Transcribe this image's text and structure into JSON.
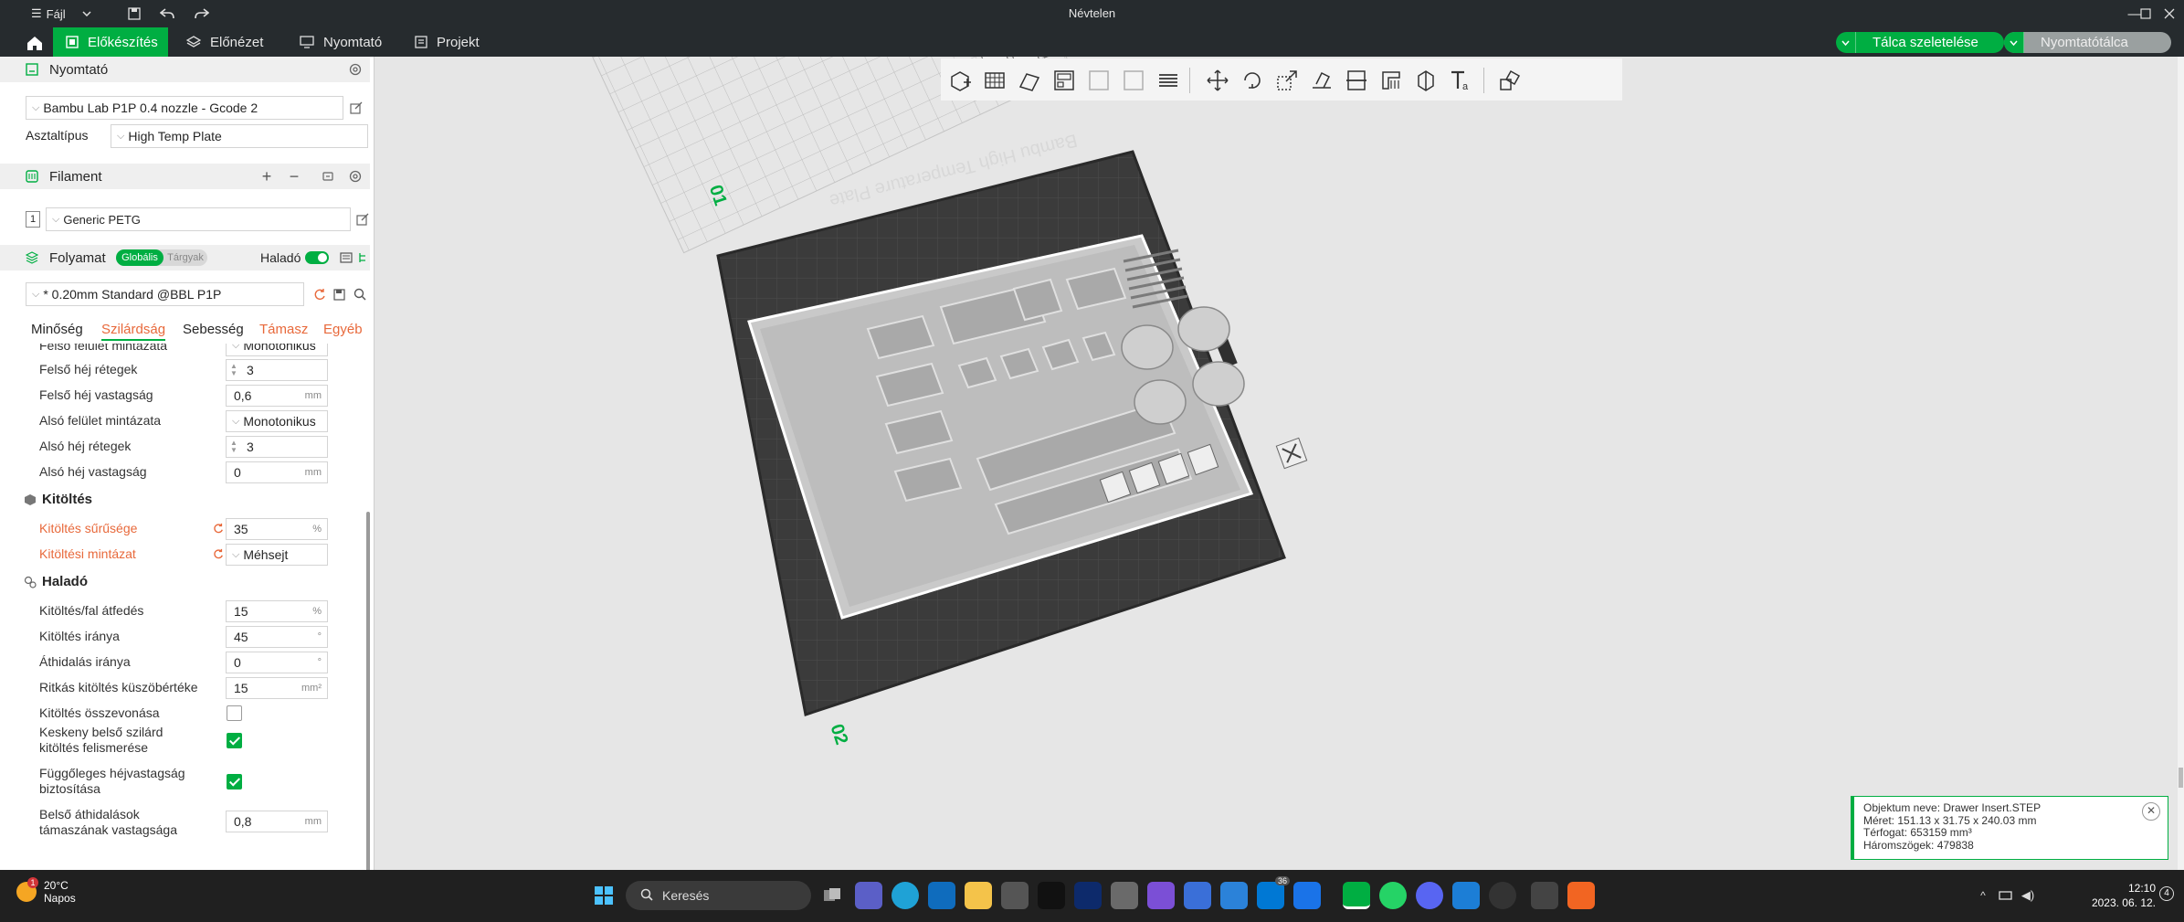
{
  "window": {
    "title": "Névtelen",
    "menu_label": "Fájl"
  },
  "tabs": [
    {
      "label": "Előkészítés"
    },
    {
      "label": "Előnézet"
    },
    {
      "label": "Nyomtató"
    },
    {
      "label": "Projekt"
    }
  ],
  "actions": {
    "slice_label": "Tálca szeletelése",
    "print_label": "Nyomtatótálca"
  },
  "printer": {
    "section_title": "Nyomtató",
    "profile": "Bambu Lab P1P 0.4 nozzle - Gcode 2",
    "plate_type_label": "Asztaltípus",
    "plate_type_value": "High Temp Plate"
  },
  "filament": {
    "section_title": "Filament",
    "slot_number": "1",
    "value": "Generic PETG"
  },
  "process": {
    "section_title": "Folyamat",
    "toggle_global": "Globális",
    "toggle_objects": "Tárgyak",
    "advanced_label": "Haladó",
    "profile": "* 0.20mm Standard @BBL P1P",
    "tabs": [
      {
        "label": "Minőség"
      },
      {
        "label": "Szilárdság"
      },
      {
        "label": "Sebesség"
      },
      {
        "label": "Támasz"
      },
      {
        "label": "Egyéb"
      }
    ]
  },
  "settings": {
    "top_pattern_label": "Felső felület mintázata",
    "top_pattern_value": "Monotonikus",
    "top_layers_label": "Felső héj rétegek",
    "top_layers_value": "3",
    "top_thickness_label": "Felső héj vastagság",
    "top_thickness_value": "0,6",
    "bottom_pattern_label": "Alsó felület mintázata",
    "bottom_pattern_value": "Monotonikus",
    "bottom_layers_label": "Alsó héj rétegek",
    "bottom_layers_value": "3",
    "bottom_thickness_label": "Alsó héj vastagság",
    "bottom_thickness_value": "0",
    "infill_group": "Kitöltés",
    "infill_density_label": "Kitöltés sűrűsége",
    "infill_density_value": "35",
    "infill_pattern_label": "Kitöltési mintázat",
    "infill_pattern_value": "Méhsejt",
    "advanced_group": "Haladó",
    "overlap_label": "Kitöltés/fal átfedés",
    "overlap_value": "15",
    "direction_label": "Kitöltés iránya",
    "direction_value": "45",
    "bridge_label": "Áthidalás iránya",
    "bridge_value": "0",
    "sparse_label": "Ritkás kitöltés küszöbértéke",
    "sparse_value": "15",
    "combine_label": "Kitöltés összevonása",
    "narrow_label_1": "Keskeny belső szilárd",
    "narrow_label_2": "kitöltés felismerése",
    "vertical_label_1": "Függőleges héjvastagság",
    "vertical_label_2": "biztosítása",
    "internal_bridge_label_1": "Belső áthidalások",
    "internal_bridge_label_2": "támaszának vastagsága",
    "internal_bridge_value": "0,8",
    "unit_mm": "mm",
    "unit_pct": "%",
    "unit_deg": "°",
    "unit_mm2": "mm²"
  },
  "viewport": {
    "plate_label_1": "01",
    "plate_label_2": "02",
    "plate_text": "Bambu High Temperature Plate"
  },
  "object_info": {
    "name": "Objektum neve: Drawer Insert.STEP",
    "size": "Méret: 151.13 x 31.75 x 240.03 mm",
    "volume": "Térfogat: 653159 mm³",
    "triangles": "Háromszögek: 479838"
  },
  "taskbar": {
    "temperature": "20°C",
    "weather": "Napos",
    "weather_badge": "1",
    "search_placeholder": "Keresés",
    "mail_badge": "36",
    "time": "12:10",
    "date": "2023. 06. 12.",
    "notification_count": "4"
  },
  "colors": {
    "accent": "#00ae42",
    "modified": "#e8693b",
    "titlebar": "#262b2e"
  }
}
